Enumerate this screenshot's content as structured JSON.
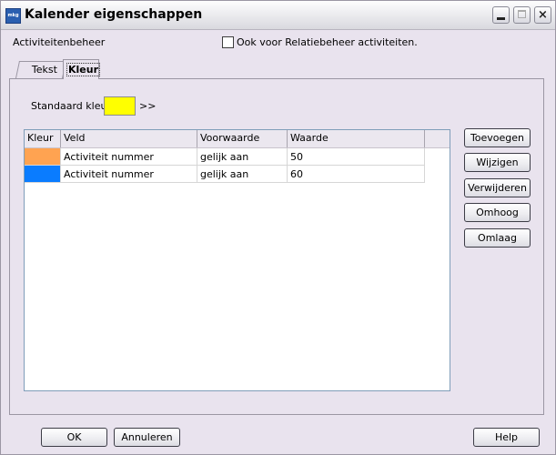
{
  "window": {
    "title": "Kalender eigenschappen",
    "app_icon_text": "mkg",
    "close_glyph": "×"
  },
  "header": {
    "section_label": "Activiteitenbeheer",
    "checkbox_label": "Ook voor Relatiebeheer activiteiten.",
    "checkbox_checked": false
  },
  "tabs": [
    {
      "label": "Tekst",
      "active": false
    },
    {
      "label": "Kleur",
      "active": true
    }
  ],
  "standard_color": {
    "label": "Standaard kleur:",
    "color": "#ffff00",
    "more_label": ">>"
  },
  "grid": {
    "columns": [
      "Kleur",
      "Veld",
      "Voorwaarde",
      "Waarde"
    ],
    "rows": [
      {
        "color": "#ffa351",
        "veld": "Activiteit nummer",
        "voorwaarde": "gelijk aan",
        "waarde": "50"
      },
      {
        "color": "#0a7cff",
        "veld": "Activiteit nummer",
        "voorwaarde": "gelijk aan",
        "waarde": "60"
      }
    ]
  },
  "side_buttons": {
    "add": "Toevoegen",
    "edit": "Wijzigen",
    "delete": "Verwijderen",
    "up": "Omhoog",
    "down": "Omlaag"
  },
  "footer": {
    "ok": "OK",
    "cancel": "Annuleren",
    "help": "Help"
  }
}
